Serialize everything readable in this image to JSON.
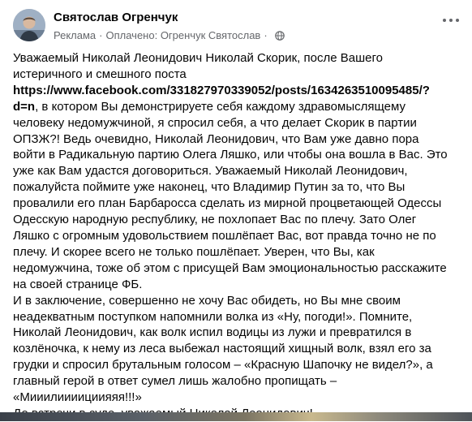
{
  "post": {
    "author_name": "Святослав Огренчук",
    "meta": {
      "sponsored": "Реклама",
      "separator": "·",
      "paid_by": "Оплачено: Огренчук Святослав",
      "audience_icon": "globe-icon"
    },
    "more_icon": "more-options-icon",
    "body": {
      "l1": "Уважаемый Николай Леонидович Николай Скорик, после Вашего",
      "l2": "истеричного и смешного поста",
      "link_a": "https://www.facebook.com/331827970339052/posts/1634263510095485/?",
      "link_b": "d=n",
      "l4_rest": ", в котором Вы демонстрируете себя каждому здравомыслящему",
      "l5": "человеку недомужчиной, я спросил себя, а что делает Скорик в партии",
      "l6": "ОПЗЖ?! Ведь очевидно, Николай Леонидович, что Вам уже давно пора",
      "l7": "войти в Радикальную партию Олега Ляшко, или чтобы она вошла в Вас. Это",
      "l8": "уже как Вам удастся договориться. Уважаемый Николай Леонидович,",
      "l9": "пожалуйста поймите уже наконец, что Владимир Путин за то, что Вы",
      "l10": "провалили его план Барбаросса сделать из мирной процветающей Одессы",
      "l11": "Одесскую народную республику, не похлопает Вас по плечу. Зато Олег",
      "l12": "Ляшко с огромным удовольствием пошлёпает Вас, вот правда точно не по",
      "l13": "плечу. И скорее всего не только пошлёпает. Уверен, что Вы, как",
      "l14": "недомужчина, тоже об этом с присущей Вам эмоциональностью расскажите",
      "l15": "на своей странице ФБ.",
      "l16": "И в заключение, совершенно не хочу Вас обидеть, но Вы мне своим",
      "l17": "неадекватным поступком напомнили волка из «Ну, погоди!». Помните,",
      "l18": "Николай Леонидович, как волк испил водицы из лужи и превратился в",
      "l19": "козлёночка, к нему из леса выбежал настоящий хищный волк, взял его за",
      "l20": "грудки и спросил брутальным голосом – «Красную Шапочку не видел?», а",
      "l21": "главный герой в ответ сумел лишь жалобно пропищать –",
      "l22": "«Мииилиииициияяя!!!»",
      "l23": "До встречи в суде, уважаемый Николай Леонидович!"
    }
  }
}
